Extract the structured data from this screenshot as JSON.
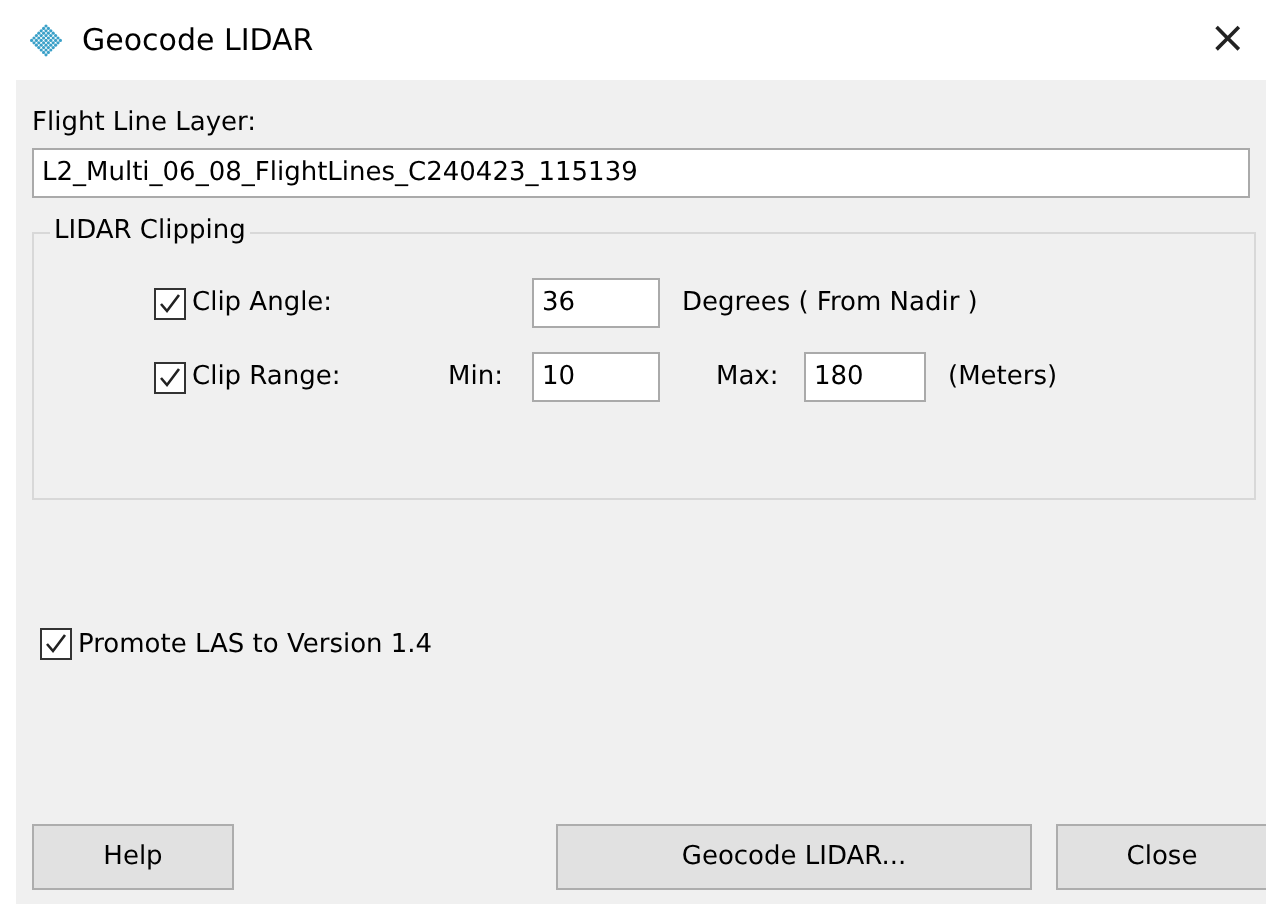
{
  "window": {
    "title": "Geocode LIDAR",
    "close": "×"
  },
  "flight_line_layer": {
    "label": "Flight Line Layer:",
    "value": "L2_Multi_06_08_FlightLines_C240423_115139"
  },
  "lidar_clipping": {
    "title": "LIDAR Clipping",
    "clip_angle": {
      "label": "Clip Angle:",
      "checked": true,
      "value": "36",
      "unit": "Degrees ( From Nadir )"
    },
    "clip_range": {
      "label": "Clip Range:",
      "checked": true,
      "min_label": "Min:",
      "min": "10",
      "max_label": "Max:",
      "max": "180",
      "unit": "(Meters)"
    }
  },
  "promote_las": {
    "label": "Promote LAS to Version 1.4",
    "checked": true
  },
  "buttons": [
    {
      "label": "Help"
    },
    {
      "label": "Geocode LIDAR..."
    },
    {
      "label": "Close"
    }
  ]
}
